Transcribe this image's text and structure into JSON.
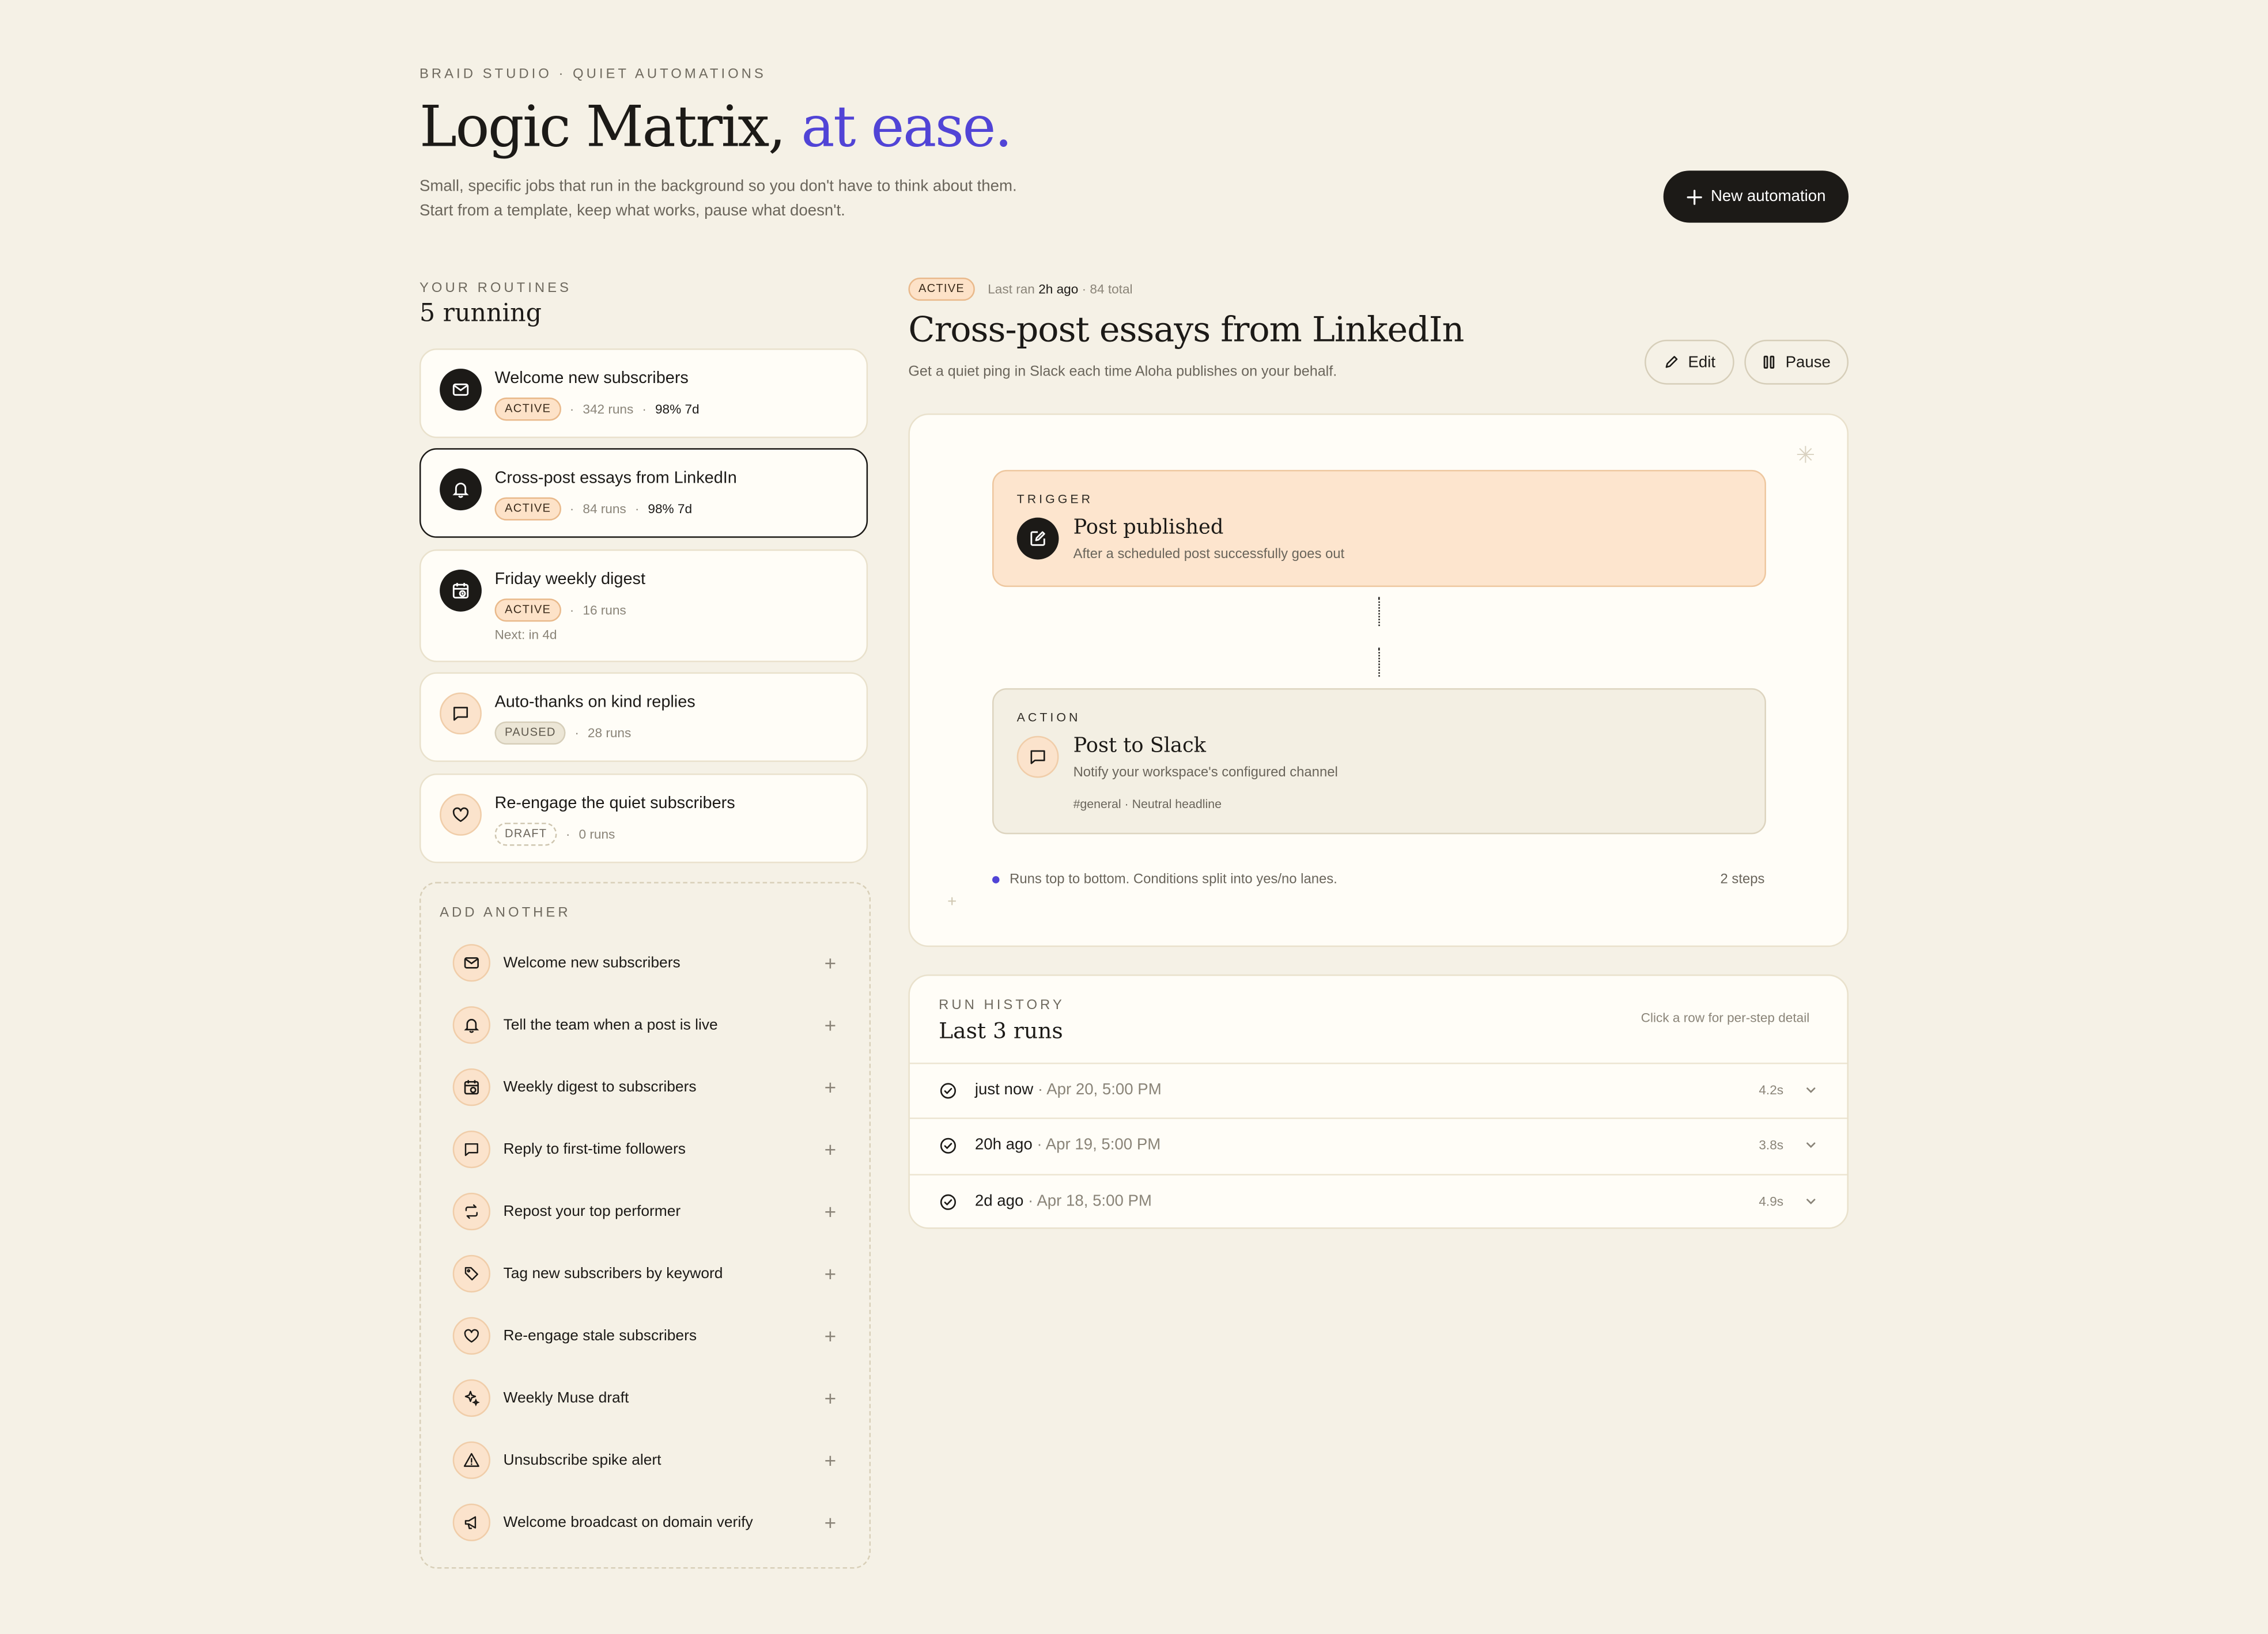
{
  "header": {
    "brand": "BRAID STUDIO · QUIET AUTOMATIONS",
    "title_main": "Logic Matrix,",
    "title_accent": "at ease.",
    "subtitle_line1": "Small, specific jobs that run in the background so you don't have to think about them.",
    "subtitle_line2": "Start from a template, keep what works, pause what doesn't.",
    "new_button": "New automation",
    "accent_color": "#5144d6"
  },
  "routines": {
    "eyebrow": "YOUR ROUTINES",
    "count": "5 running",
    "items": [
      {
        "name": "Welcome new subscribers",
        "status": "ACTIVE",
        "runs": "342 runs",
        "rate": "98% 7d",
        "icon": "mail-icon"
      },
      {
        "name": "Cross-post essays from LinkedIn",
        "status": "ACTIVE",
        "runs": "84 runs",
        "rate": "98% 7d",
        "icon": "bell-icon"
      },
      {
        "name": "Friday weekly digest",
        "status": "ACTIVE",
        "runs": "16 runs",
        "next": "Next: in 4d",
        "icon": "calendar-clock-icon"
      },
      {
        "name": "Auto-thanks on kind replies",
        "status": "PAUSED",
        "runs": "28 runs",
        "icon": "message-icon"
      },
      {
        "name": "Re-engage the quiet subscribers",
        "status": "DRAFT",
        "runs": "0 runs",
        "icon": "heart-icon"
      }
    ]
  },
  "add_another": {
    "eyebrow": "ADD ANOTHER",
    "templates": [
      {
        "name": "Welcome new subscribers",
        "icon": "mail-icon"
      },
      {
        "name": "Tell the team when a post is live",
        "icon": "bell-icon"
      },
      {
        "name": "Weekly digest to subscribers",
        "icon": "calendar-clock-icon"
      },
      {
        "name": "Reply to first-time followers",
        "icon": "message-icon"
      },
      {
        "name": "Repost your top performer",
        "icon": "repost-icon"
      },
      {
        "name": "Tag new subscribers by keyword",
        "icon": "tag-icon"
      },
      {
        "name": "Re-engage stale subscribers",
        "icon": "heart-icon"
      },
      {
        "name": "Weekly Muse draft",
        "icon": "sparkles-icon"
      },
      {
        "name": "Unsubscribe spike alert",
        "icon": "alert-icon"
      },
      {
        "name": "Welcome broadcast on domain verify",
        "icon": "megaphone-icon"
      }
    ]
  },
  "detail": {
    "status": "ACTIVE",
    "last_ran_prefix": "Last ran",
    "last_ran": "2h ago",
    "total": "· 84 total",
    "title": "Cross-post essays from LinkedIn",
    "subtitle": "Get a quiet ping in Slack each time Aloha publishes on your behalf.",
    "edit_label": "Edit",
    "pause_label": "Pause",
    "trigger": {
      "eyebrow": "TRIGGER",
      "title": "Post published",
      "subtitle": "After a scheduled post successfully goes out"
    },
    "action": {
      "eyebrow": "ACTION",
      "title": "Post to Slack",
      "subtitle": "Notify your workspace's configured channel",
      "detail": "#general · Neutral headline"
    },
    "legend": "Runs top to bottom. Conditions split into yes/no lanes.",
    "steps": "2 steps"
  },
  "history": {
    "eyebrow": "RUN HISTORY",
    "title": "Last 3 runs",
    "hint": "Click a row for per-step detail",
    "runs": [
      {
        "when": "just now",
        "date": " · Apr 20, 5:00 PM",
        "duration": "4.2s"
      },
      {
        "when": "20h ago",
        "date": " · Apr 19, 5:00 PM",
        "duration": "3.8s"
      },
      {
        "when": "2d ago",
        "date": " · Apr 18, 5:00 PM",
        "duration": "4.9s"
      }
    ]
  }
}
